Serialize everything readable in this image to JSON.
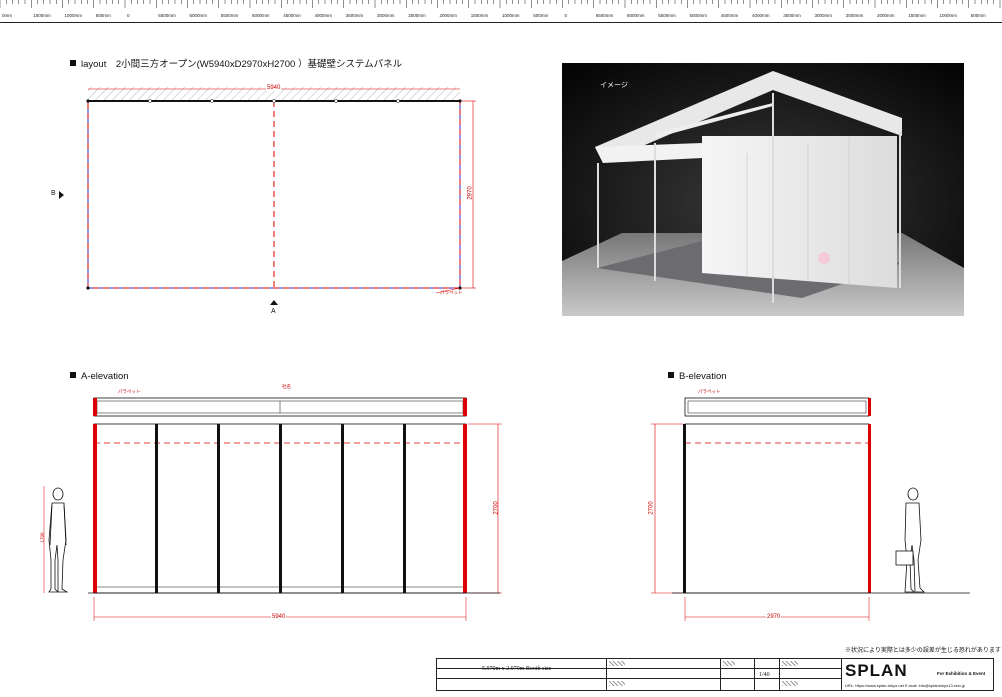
{
  "ruler": {
    "labels": [
      "0mm",
      "1500mm",
      "1000mm",
      "500mm",
      "0",
      "6500mm",
      "6000mm",
      "5500mm",
      "5000mm",
      "4500mm",
      "4000mm",
      "3500mm",
      "3000mm",
      "2500mm",
      "2000mm",
      "1500mm",
      "1000mm",
      "500mm",
      "0",
      "6500mm",
      "6000mm",
      "5500mm",
      "5000mm",
      "4500mm",
      "4000mm",
      "3500mm",
      "3000mm",
      "2500mm",
      "2000mm",
      "1500mm",
      "1000mm",
      "500mm"
    ]
  },
  "layout": {
    "title": "layout　2小間三方オープン(W5940xD2970xH2700 ）基礎壁システムパネル",
    "width_dim": "5940",
    "depth_dim": "2970",
    "marker_b": "B",
    "marker_a": "A",
    "fascia_tag": "パラペット"
  },
  "render": {
    "label": "イメージ"
  },
  "a_elevation": {
    "title": "A-elevation",
    "fascia_tag": "パラペット",
    "center_tag": "社名",
    "height_dim": "2700",
    "width_dim": "5940",
    "person_dim": "1700"
  },
  "b_elevation": {
    "title": "B-elevation",
    "fascia_tag": "パラペット",
    "height_dim": "2700",
    "width_dim": "2970"
  },
  "note": "※状況により実際とは多少の誤差が生じる恐れがあります",
  "titleblock": {
    "booth_size": "5.970m x 2.970m Booth size",
    "scale": "1/40",
    "brand": "SPLAN",
    "brand_sub": "For Exhibition & Event",
    "brand_url": "URL: https://www.splan-tokyo.net  E-mail: info@splantokyo13.xsrv.jp"
  }
}
